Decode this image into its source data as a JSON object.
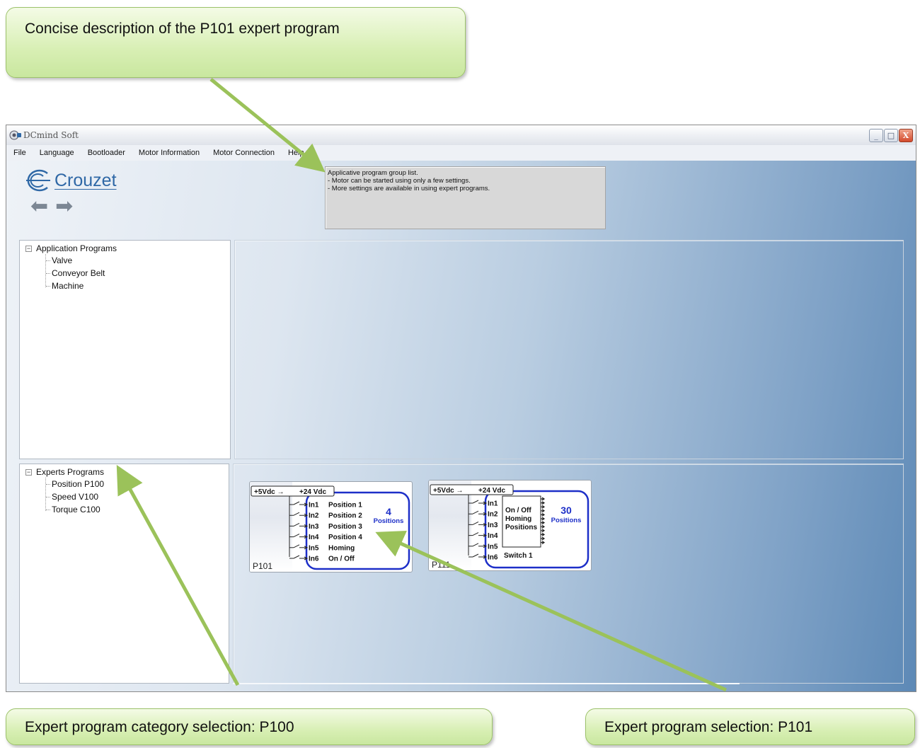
{
  "callouts": {
    "top": "Concise description of the P101 expert program",
    "left": "Expert program category selection: P100",
    "right": "Expert program selection: P101"
  },
  "window": {
    "title": "DCmind Soft",
    "controls": [
      "_",
      "□",
      "X"
    ]
  },
  "menu": [
    "File",
    "Language",
    "Bootloader",
    "Motor Information",
    "Motor Connection",
    "Help"
  ],
  "logo": {
    "text": "Crouzet"
  },
  "description": {
    "line1": "Applicative program group list.",
    "line2": "- Motor can be started using only a few settings.",
    "line3": "- More settings are available in using  expert programs."
  },
  "tree_application": {
    "root": "Application Programs",
    "items": [
      "Valve",
      "Conveyor Belt",
      "Machine"
    ]
  },
  "tree_experts": {
    "root": "Experts Programs",
    "items": [
      "Position P100",
      "Speed V100",
      "Torque C100"
    ]
  },
  "cards": [
    {
      "label": "P101",
      "supply_left": "+5Vdc →",
      "supply_right": "+24 Vdc",
      "inputs": [
        "In1",
        "In2",
        "In3",
        "In4",
        "In5",
        "In6"
      ],
      "functions": [
        "Position 1",
        "Position 2",
        "Position 3",
        "Position 4",
        "Homing",
        "On / Off"
      ],
      "count": "4",
      "count_label": "Positions"
    },
    {
      "label": "P111",
      "supply_left": "+5Vdc →",
      "supply_right": "+24 Vdc",
      "inputs": [
        "In1",
        "In2",
        "In3",
        "In4",
        "In5",
        "In6"
      ],
      "box_lines": [
        "On / Off",
        "Homing",
        "Positions"
      ],
      "switch": "Switch 1",
      "count": "30",
      "count_label": "Positions"
    }
  ],
  "colors": {
    "callout_fill": "#d8efb4",
    "arrow": "#9bc25a",
    "card_blue": "#1d2fc8",
    "logo_blue": "#2f68a6"
  }
}
